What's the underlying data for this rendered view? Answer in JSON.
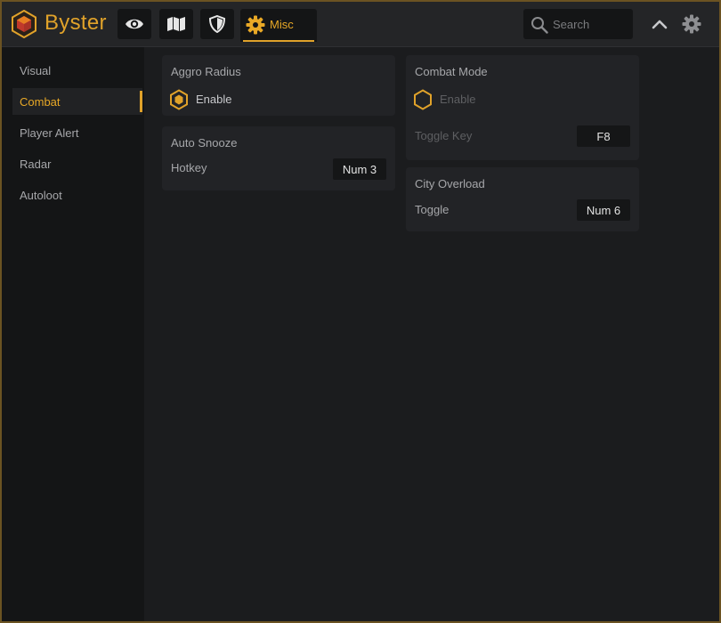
{
  "app": {
    "brand": "Byster"
  },
  "nav": {
    "icons": [
      "eye-icon",
      "map-icon",
      "shield-icon"
    ],
    "misc_label": "Misc"
  },
  "search": {
    "placeholder": "Search"
  },
  "sidebar": {
    "items": [
      {
        "label": "Visual",
        "active": false
      },
      {
        "label": "Combat",
        "active": true
      },
      {
        "label": "Player Alert",
        "active": false
      },
      {
        "label": "Radar",
        "active": false
      },
      {
        "label": "Autoloot",
        "active": false
      }
    ]
  },
  "cards": {
    "aggro": {
      "title": "Aggro Radius",
      "enable_label": "Enable",
      "enabled": true
    },
    "snooze": {
      "title": "Auto Snooze",
      "hotkey_label": "Hotkey",
      "hotkey_value": "Num 3"
    },
    "combat_mode": {
      "title": "Combat Mode",
      "enable_label": "Enable",
      "enabled": false,
      "toggle_key_label": "Toggle Key",
      "toggle_key_value": "F8"
    },
    "city": {
      "title": "City Overload",
      "toggle_label": "Toggle",
      "toggle_value": "Num 6"
    }
  },
  "colors": {
    "accent": "#e0a22a",
    "background": "#1b1c1e",
    "sidebar": "#141516",
    "card": "#222326"
  }
}
